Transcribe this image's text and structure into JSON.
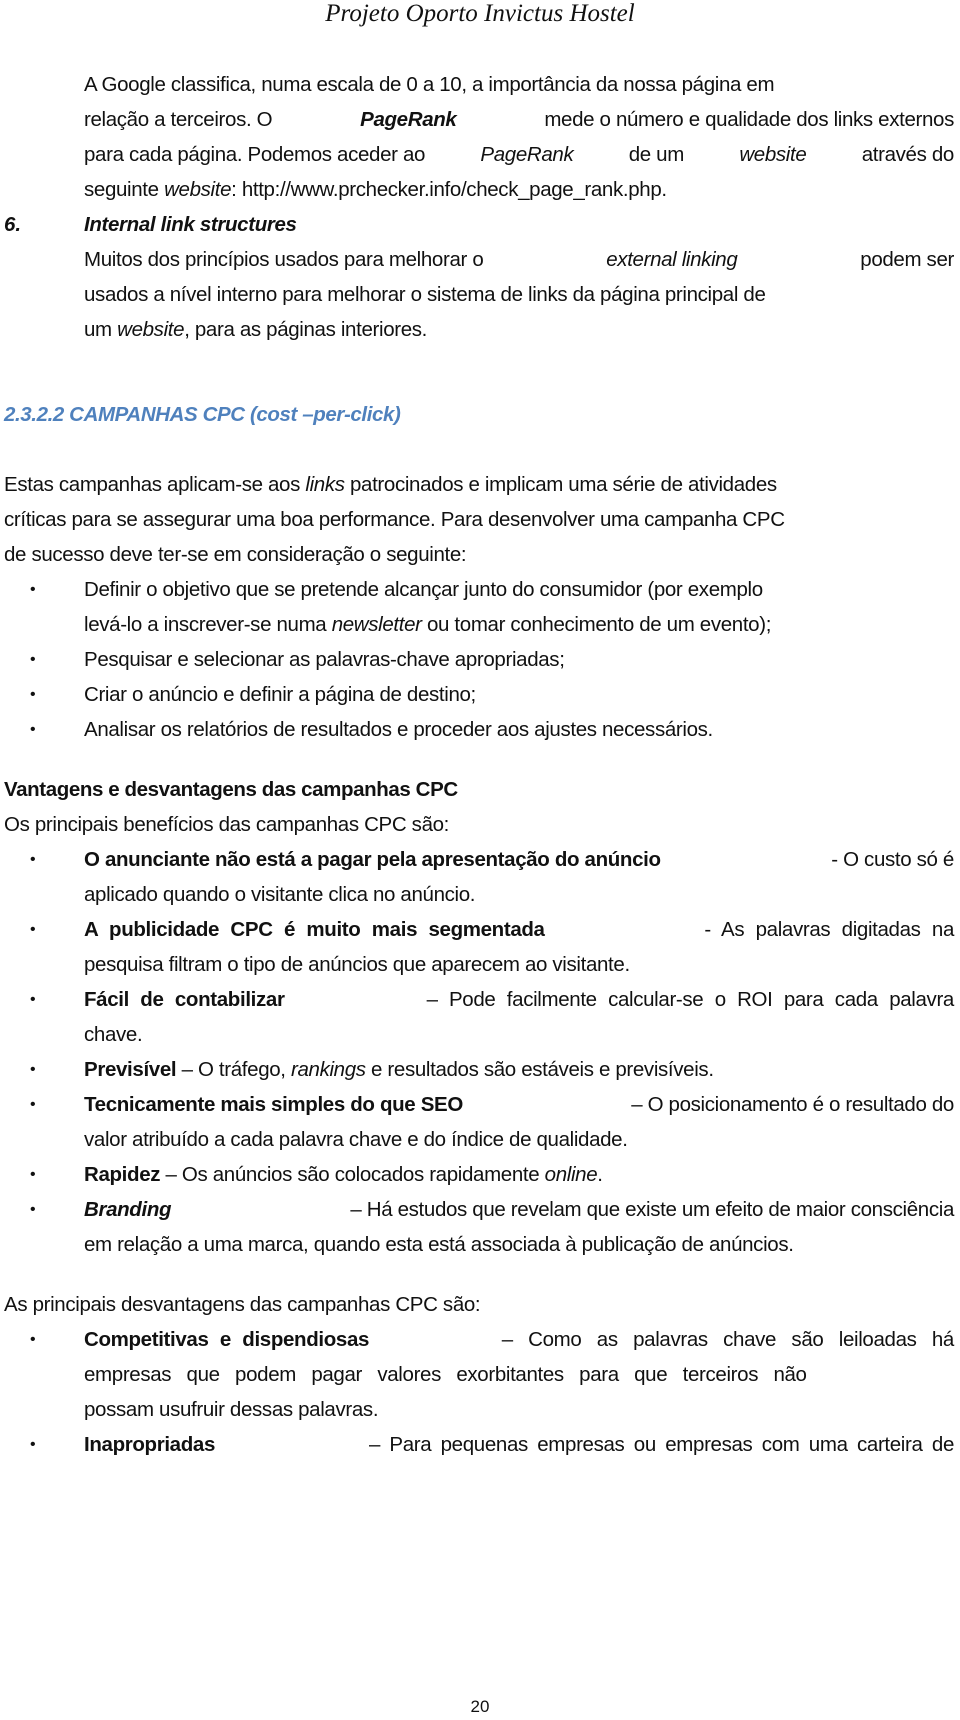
{
  "header": {
    "title": "Projeto Oporto Invictus Hostel"
  },
  "intro": {
    "lines": [
      "A Google classifica, numa escala de 0 a 10, a importância da nossa página em",
      [
        "relação a terceiros. O ",
        "PageRank",
        " mede o número e qualidade dos links externos"
      ],
      [
        "para cada página. Podemos aceder ao ",
        "PageRank",
        " de um ",
        "website",
        " através do"
      ],
      [
        "seguinte ",
        "website",
        ": http://www.prchecker.info/check_page_rank.php."
      ]
    ]
  },
  "item6": {
    "number": "6.",
    "title": "Internal link structures",
    "lines": [
      [
        "Muitos dos princípios usados para melhorar o ",
        "external linking",
        " podem ser"
      ],
      "usados a nível interno para melhorar o sistema de links da página principal de",
      [
        "um ",
        "website",
        ", para as páginas interiores."
      ]
    ]
  },
  "section": {
    "heading": "2.3.2.2 CAMPANHAS CPC (cost –per-click)",
    "heading_color": "#4f81bd",
    "paragraph": [
      [
        "Estas campanhas aplicam-se aos ",
        "links",
        " patrocinados e implicam uma série de atividades"
      ],
      "críticas para se assegurar uma boa performance. Para desenvolver uma campanha CPC",
      "de sucesso deve ter-se em consideração o seguinte:"
    ],
    "steps": [
      {
        "lines": [
          "Definir o objetivo que se pretende alcançar junto do consumidor (por exemplo",
          [
            "levá-lo a inscrever-se numa ",
            "newsletter",
            " ou tomar conhecimento de um evento);"
          ]
        ]
      },
      {
        "lines": [
          "Pesquisar e selecionar as palavras-chave apropriadas;"
        ]
      },
      {
        "lines": [
          "Criar o anúncio e definir a página de destino;"
        ]
      },
      {
        "lines": [
          "Analisar os relatórios de resultados e proceder aos ajustes necessários."
        ]
      }
    ]
  },
  "pros_cons": {
    "heading": "Vantagens e desvantagens das campanhas CPC",
    "benefits_intro": "Os principais benefícios das campanhas CPC são:",
    "benefits": [
      {
        "term": "O anunciante não está a pagar pela apresentação do anúncio",
        "rest1": " - O custo só é",
        "rest2": "aplicado quando o visitante clica no anúncio."
      },
      {
        "term": "A publicidade CPC é muito mais segmentada",
        "rest1": " - As palavras digitadas na",
        "rest2": "pesquisa filtram o tipo de anúncios que aparecem ao visitante."
      },
      {
        "term": "Fácil de contabilizar",
        "rest1": " – Pode facilmente calcular-se o ROI para cada palavra",
        "rest2": "chave."
      },
      {
        "term": "Previsível",
        "rest1a": " – O tráfego, ",
        "rest1i": "rankings",
        "rest1b": " e resultados são estáveis e previsíveis."
      },
      {
        "term": "Tecnicamente mais simples do que SEO",
        "rest1": " – O posicionamento é o resultado do",
        "rest2": "valor atribuído a cada palavra chave e do índice de qualidade."
      },
      {
        "term": "Rapidez",
        "rest1a": " – Os anúncios são colocados rapidamente ",
        "rest1i": "online",
        "rest1b": "."
      },
      {
        "term": "Branding",
        "rest1": " – Há estudos que revelam que existe um efeito de maior consciência",
        "rest2": "em relação a uma marca, quando esta está associada à publicação de anúncios."
      }
    ],
    "drawbacks_intro": "As principais desvantagens das campanhas CPC são:",
    "drawbacks": [
      {
        "term": "Competitivas e dispendiosas",
        "rest1": " – Como as palavras chave são leiloadas há",
        "rest2": "empresas que podem pagar valores exorbitantes para que terceiros não",
        "rest3": "possam usufruir dessas palavras."
      },
      {
        "term": "Inapropriadas",
        "rest1": " – Para pequenas empresas ou empresas com uma carteira de"
      }
    ]
  },
  "footer": {
    "page_number": "20"
  }
}
